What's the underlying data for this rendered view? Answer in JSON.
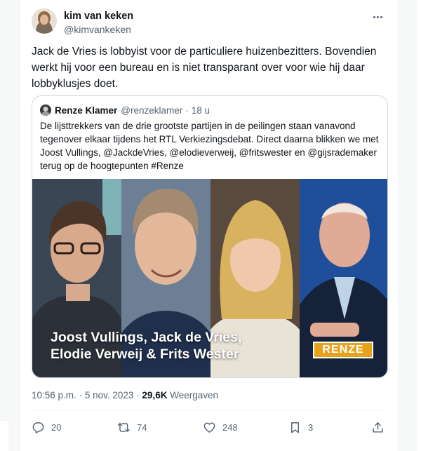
{
  "author": {
    "name": "kim van keken",
    "handle": "@kimvankeken"
  },
  "tweet": {
    "text": "Jack de Vries is lobbyist voor de particuliere huizenbezitters. Bovendien werkt hij voor een bureau en is niet transparant over voor wie hij daar lobbyklusjes doet."
  },
  "quote": {
    "name": "Renze Klamer",
    "handle": "@renzeklamer",
    "separator": "·",
    "time": "18 u",
    "text": "De lijsttrekkers van de drie grootste partijen in de peilingen staan vanavond tegenover elkaar tijdens het RTL Verkiezingsdebat. Direct daarna blikken we met Joost Vullings, @JackdeVries, @elodieverweij, @fritswester en @gijsrademaker terug op de hoogtepunten #Renze",
    "media": {
      "caption_line1": "Joost Vullings, Jack de Vries,",
      "caption_line2": "Elodie Verweij & Frits Wester",
      "brand": "RENZE"
    }
  },
  "meta": {
    "time": "10:56 p.m.",
    "dot": "·",
    "date": "5 nov. 2023",
    "views_count": "29,6K",
    "views_label": "Weergaven"
  },
  "actions": {
    "replies": "20",
    "reposts": "74",
    "likes": "248",
    "bookmarks": "3"
  },
  "icons": {
    "more": "more-horizontal-icon",
    "reply": "reply-icon",
    "repost": "repost-icon",
    "like": "heart-icon",
    "bookmark": "bookmark-icon",
    "share": "share-icon"
  },
  "colors": {
    "text": "#0f1419",
    "secondary": "#536471",
    "border": "#cfd9de",
    "brand_orange": "#e6a21a"
  }
}
